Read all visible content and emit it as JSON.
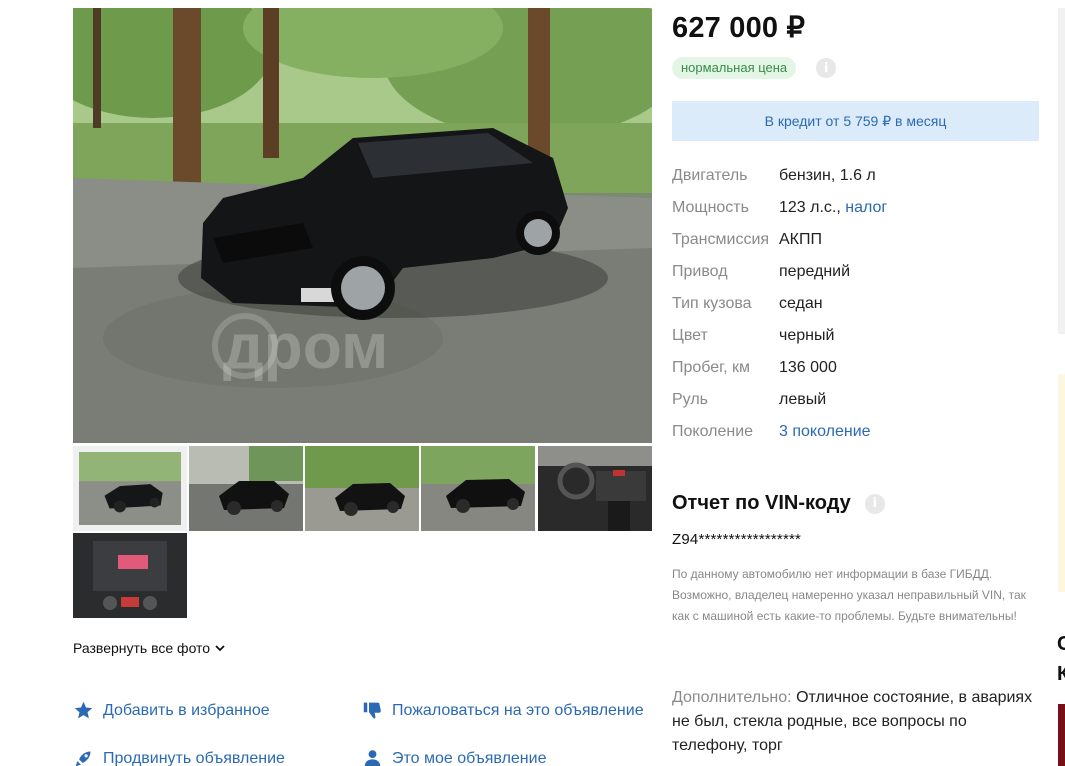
{
  "listing": {
    "price": "627 000 ₽",
    "price_badge": "нормальная цена",
    "price_info_icon": "info-icon",
    "credit_text": "В кредит от 5 759 ₽ в месяц"
  },
  "specs": [
    {
      "key": "Двигатель",
      "value": "бензин, 1.6 л"
    },
    {
      "key": "Мощность",
      "value": "123 л.с.,",
      "link": "налог"
    },
    {
      "key": "Трансмиссия",
      "value": "АКПП"
    },
    {
      "key": "Привод",
      "value": "передний"
    },
    {
      "key": "Тип кузова",
      "value": "седан"
    },
    {
      "key": "Цвет",
      "value": "черный"
    },
    {
      "key": "Пробег, км",
      "value": "136 000"
    },
    {
      "key": "Руль",
      "value": "левый"
    },
    {
      "key": "Поколение",
      "value": "",
      "link": "3 поколение"
    }
  ],
  "vin": {
    "title": "Отчет по VIN-коду",
    "code": "Z94*****************",
    "note": "По данному автомобилю нет информации в базе ГИБДД. Возможно, владелец намеренно указал неправильный VIN, так как с машиной есть какие-то проблемы. Будьте внимательны!"
  },
  "extra": {
    "label": "Дополнительно:",
    "text": "Отличное состояние, в авариях не был, стекла родные, все вопросы по телефону, торг"
  },
  "gallery": {
    "watermark": "дром",
    "expand_label": "Развернуть все фото",
    "thumbnail_count": 6
  },
  "actions": {
    "favorite": "Добавить в избранное",
    "report": "Пожаловаться на это объявление",
    "promote": "Продвинуть объявление",
    "mine": "Это мое объявление"
  },
  "right_edge": {
    "fragment_text": "С К"
  },
  "colors": {
    "link": "#2b6ab3",
    "badge_bg": "#e3f6e6",
    "badge_text": "#3b8a4a",
    "credit_bg": "#dcebfa",
    "label_gray": "#8a8a8a"
  }
}
